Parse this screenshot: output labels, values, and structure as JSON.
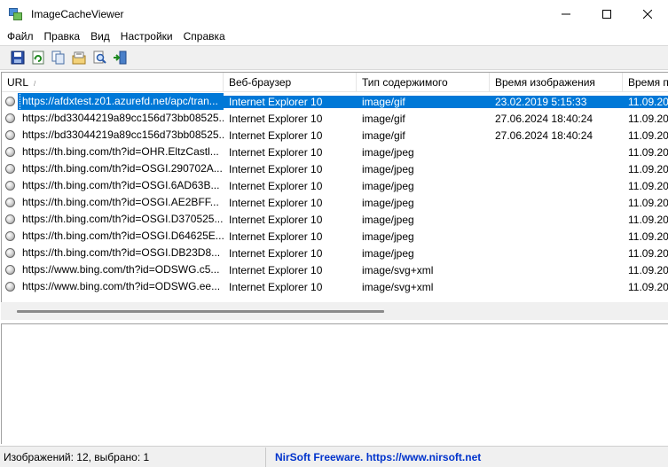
{
  "window": {
    "title": "ImageCacheViewer",
    "minimize": "—",
    "maximize": "☐",
    "close": "✕"
  },
  "menu": [
    "Файл",
    "Правка",
    "Вид",
    "Настройки",
    "Справка"
  ],
  "toolbar": {
    "buttons": [
      "save-icon",
      "refresh-icon",
      "copy-icon",
      "properties-icon",
      "find-icon",
      "exit-icon"
    ]
  },
  "list": {
    "columns": [
      "URL",
      "Веб-браузер",
      "Тип содержимого",
      "Время изображения",
      "Время п"
    ],
    "sort_indicator": "/",
    "rows": [
      {
        "url": "https://afdxtest.z01.azurefd.net/apc/tran...",
        "browser": "Internet Explorer 10",
        "type": "image/gif",
        "image_time": "23.02.2019 5:15:33",
        "time2": "11.09.20",
        "selected": true
      },
      {
        "url": "https://bd33044219a89cc156d73bb08525...",
        "browser": "Internet Explorer 10",
        "type": "image/gif",
        "image_time": "27.06.2024 18:40:24",
        "time2": "11.09.20"
      },
      {
        "url": "https://bd33044219a89cc156d73bb08525...",
        "browser": "Internet Explorer 10",
        "type": "image/gif",
        "image_time": "27.06.2024 18:40:24",
        "time2": "11.09.20"
      },
      {
        "url": "https://th.bing.com/th?id=OHR.EltzCastl...",
        "browser": "Internet Explorer 10",
        "type": "image/jpeg",
        "image_time": "",
        "time2": "11.09.20"
      },
      {
        "url": "https://th.bing.com/th?id=OSGI.290702A...",
        "browser": "Internet Explorer 10",
        "type": "image/jpeg",
        "image_time": "",
        "time2": "11.09.20"
      },
      {
        "url": "https://th.bing.com/th?id=OSGI.6AD63B...",
        "browser": "Internet Explorer 10",
        "type": "image/jpeg",
        "image_time": "",
        "time2": "11.09.20"
      },
      {
        "url": "https://th.bing.com/th?id=OSGI.AE2BFF...",
        "browser": "Internet Explorer 10",
        "type": "image/jpeg",
        "image_time": "",
        "time2": "11.09.20"
      },
      {
        "url": "https://th.bing.com/th?id=OSGI.D370525...",
        "browser": "Internet Explorer 10",
        "type": "image/jpeg",
        "image_time": "",
        "time2": "11.09.20"
      },
      {
        "url": "https://th.bing.com/th?id=OSGI.D64625E...",
        "browser": "Internet Explorer 10",
        "type": "image/jpeg",
        "image_time": "",
        "time2": "11.09.20"
      },
      {
        "url": "https://th.bing.com/th?id=OSGI.DB23D8...",
        "browser": "Internet Explorer 10",
        "type": "image/jpeg",
        "image_time": "",
        "time2": "11.09.20"
      },
      {
        "url": "https://www.bing.com/th?id=ODSWG.c5...",
        "browser": "Internet Explorer 10",
        "type": "image/svg+xml",
        "image_time": "",
        "time2": "11.09.20"
      },
      {
        "url": "https://www.bing.com/th?id=ODSWG.ee...",
        "browser": "Internet Explorer 10",
        "type": "image/svg+xml",
        "image_time": "",
        "time2": "11.09.20"
      }
    ]
  },
  "status": {
    "count": "Изображений: 12, выбрано: 1",
    "link": "NirSoft Freeware. https://www.nirsoft.net"
  },
  "colors": {
    "selection": "#0078d7",
    "link": "#0033cc"
  }
}
